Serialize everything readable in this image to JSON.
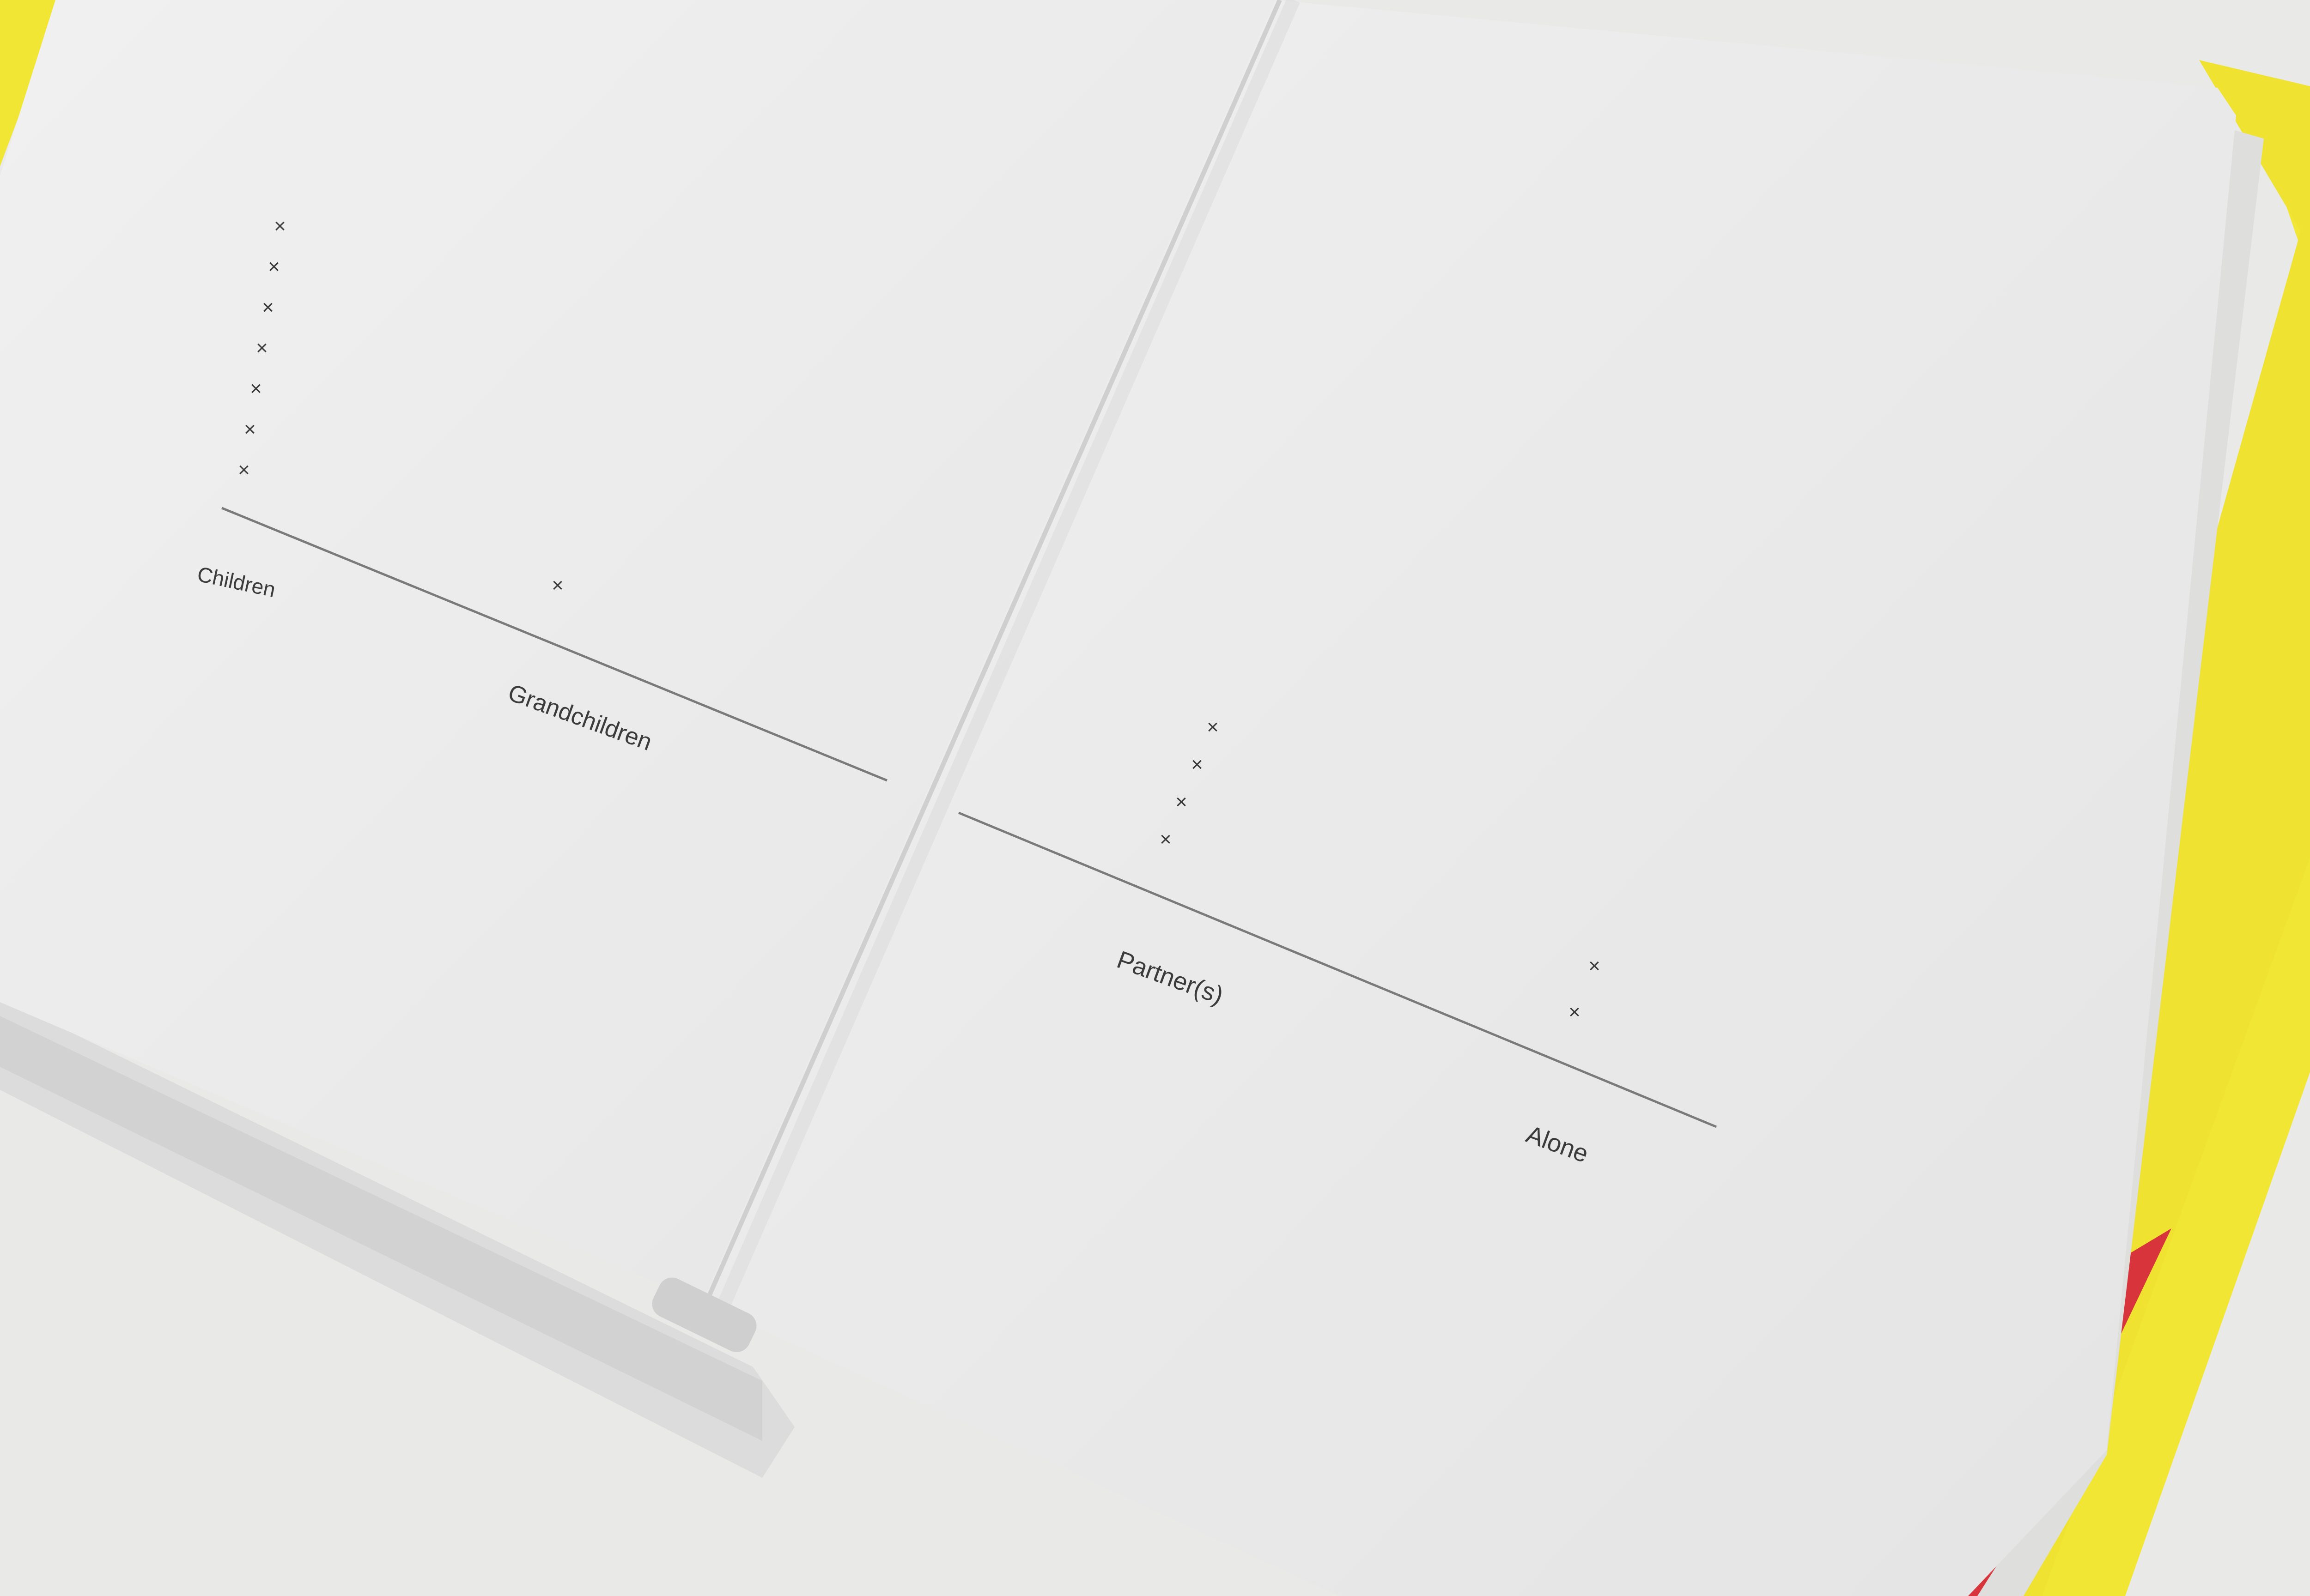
{
  "photo": {
    "colors": {
      "background": "#e9e9e7",
      "cover_yellow": "#f2e634",
      "cover_red": "#d8343b",
      "page": "#f2f2f2",
      "ink": "#3a3a3a",
      "rule": "#7a7a7a"
    }
  },
  "left_page": {
    "chart_data": {
      "type": "scatter",
      "categories": [
        "Children",
        "Grandchildren"
      ],
      "counts": [
        7,
        1
      ],
      "marker": "x"
    }
  },
  "right_page": {
    "chart_data": {
      "type": "scatter",
      "categories": [
        "Partner(s)",
        "Alone"
      ],
      "counts": [
        4,
        2
      ],
      "marker": "x"
    }
  }
}
